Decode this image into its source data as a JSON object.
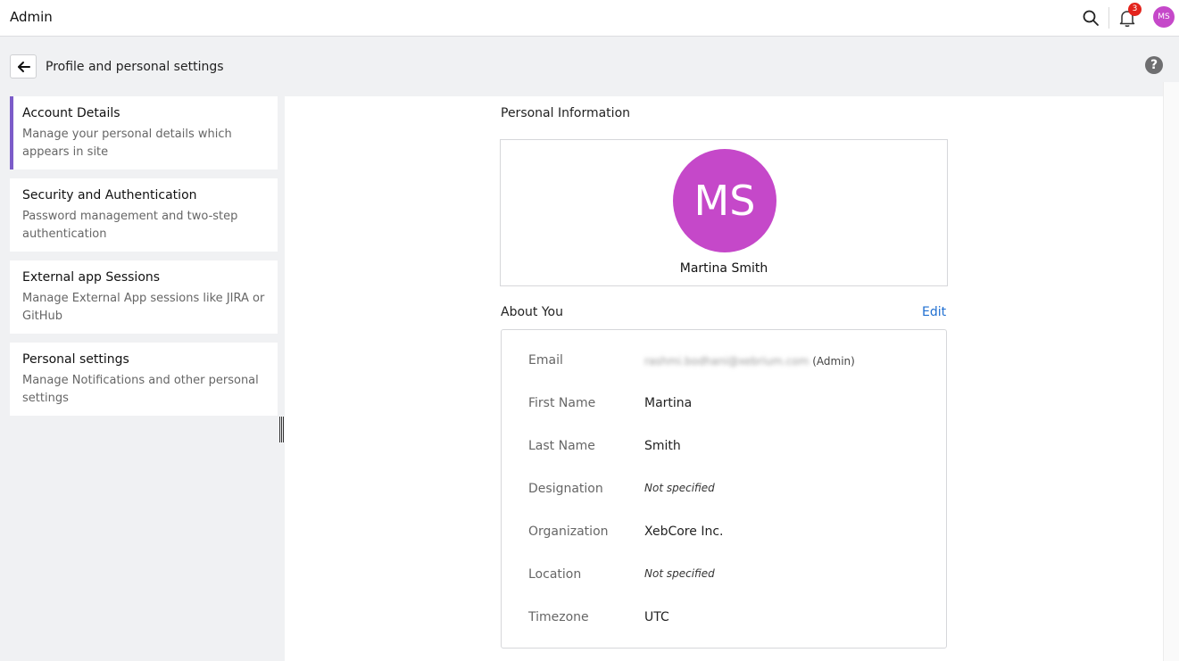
{
  "header": {
    "app_title": "Admin",
    "notification_count": "3",
    "user_initials": "MS"
  },
  "page": {
    "title": "Profile and personal settings",
    "help_glyph": "?"
  },
  "sidebar": {
    "items": [
      {
        "title": "Account Details",
        "description": "Manage your personal details which appears in site",
        "active": true
      },
      {
        "title": "Security and Authentication",
        "description": "Password management and two-step authentication",
        "active": false
      },
      {
        "title": "External app Sessions",
        "description": "Manage External App sessions like JIRA or GitHub",
        "active": false
      },
      {
        "title": "Personal settings",
        "description": "Manage Notifications and other personal settings",
        "active": false
      }
    ]
  },
  "personal_info": {
    "heading": "Personal Information",
    "avatar_initials": "MS",
    "full_name": "Martina Smith"
  },
  "about": {
    "heading": "About You",
    "edit_label": "Edit",
    "fields": [
      {
        "label": "Email",
        "value": "rashmi.bodhani@xebrium.com",
        "role": "(Admin)"
      },
      {
        "label": "First Name",
        "value": "Martina"
      },
      {
        "label": "Last Name",
        "value": "Smith"
      },
      {
        "label": "Designation",
        "value": "Not specified"
      },
      {
        "label": "Organization",
        "value": "XebCore Inc."
      },
      {
        "label": "Location",
        "value": "Not specified"
      },
      {
        "label": "Timezone",
        "value": "UTC"
      }
    ]
  },
  "colors": {
    "accent": "#7c5cc9",
    "avatar": "#c548c9",
    "link": "#1f6fd1",
    "badge": "#e3231c"
  },
  "icons": {
    "search": "search-icon",
    "notifications": "bell-icon",
    "back": "arrow-left-icon",
    "help": "help-icon"
  }
}
